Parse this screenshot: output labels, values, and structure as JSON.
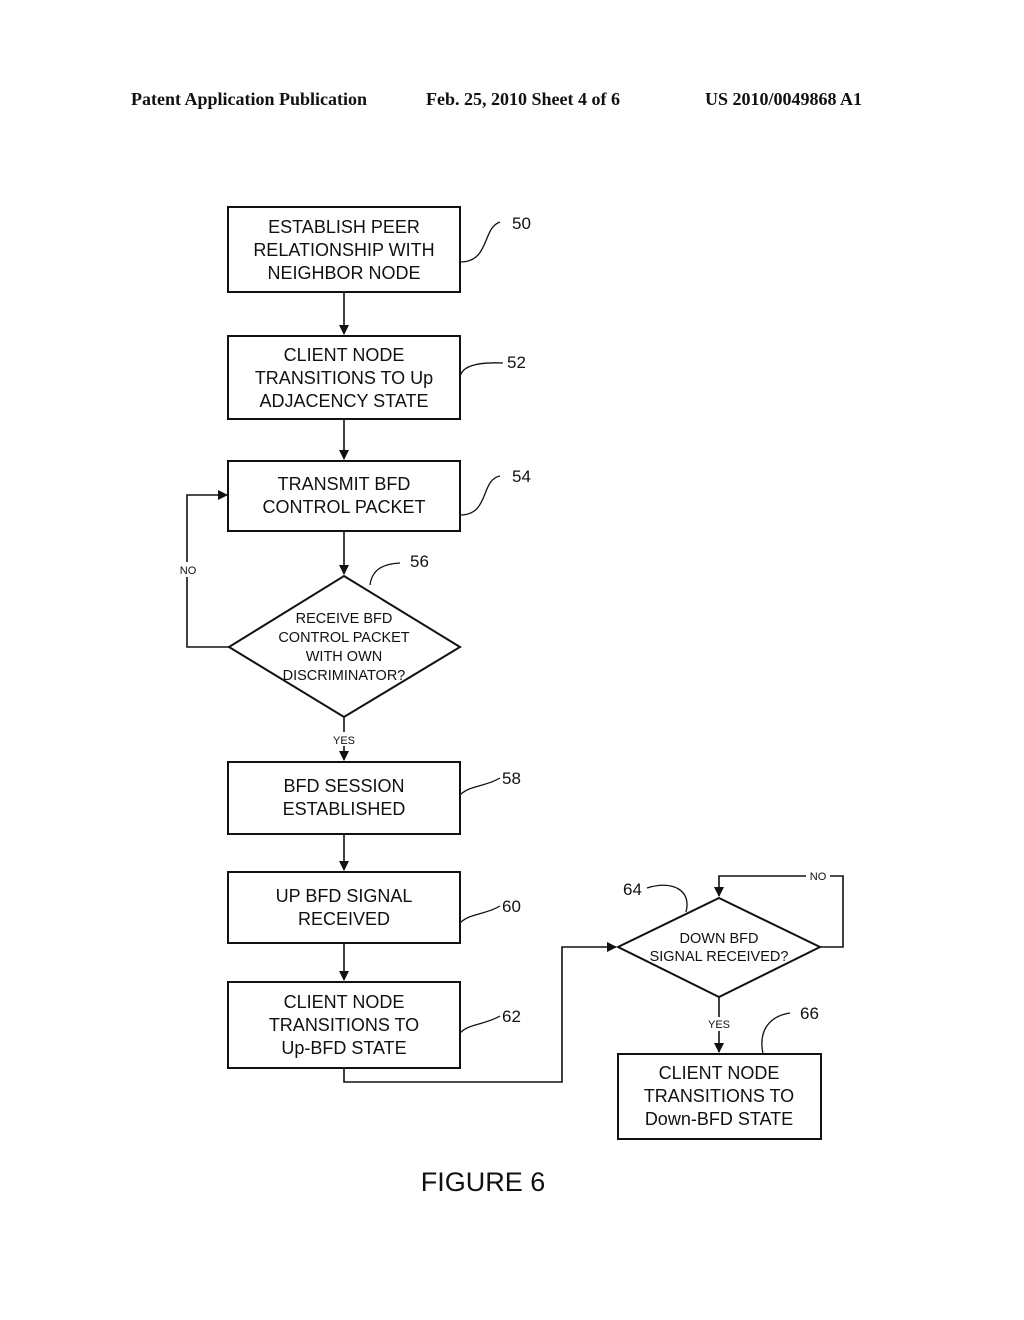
{
  "header": {
    "publication": "Patent Application Publication",
    "date_sheet": "Feb. 25, 2010   Sheet 4 of 6",
    "number": "US 2010/0049868 A1"
  },
  "nodes": {
    "n50": {
      "ref": "50",
      "lines": [
        "ESTABLISH PEER",
        "RELATIONSHIP WITH",
        "NEIGHBOR NODE"
      ]
    },
    "n52": {
      "ref": "52",
      "lines": [
        "CLIENT NODE",
        "TRANSITIONS TO Up",
        "ADJACENCY STATE"
      ]
    },
    "n54": {
      "ref": "54",
      "lines": [
        "TRANSMIT BFD",
        "CONTROL PACKET"
      ]
    },
    "n56": {
      "ref": "56",
      "lines": [
        "RECEIVE BFD",
        "CONTROL PACKET",
        "WITH OWN",
        "DISCRIMINATOR?"
      ]
    },
    "n58": {
      "ref": "58",
      "lines": [
        "BFD SESSION",
        "ESTABLISHED"
      ]
    },
    "n60": {
      "ref": "60",
      "lines": [
        "UP BFD SIGNAL",
        "RECEIVED"
      ]
    },
    "n62": {
      "ref": "62",
      "lines": [
        "CLIENT NODE",
        "TRANSITIONS TO",
        "Up-BFD STATE"
      ]
    },
    "n64": {
      "ref": "64",
      "lines": [
        "DOWN BFD",
        "SIGNAL RECEIVED?"
      ]
    },
    "n66": {
      "ref": "66",
      "lines": [
        "CLIENT NODE",
        "TRANSITIONS TO",
        "Down-BFD STATE"
      ]
    }
  },
  "edge_labels": {
    "no_56": "NO",
    "yes_56": "YES",
    "no_64": "NO",
    "yes_64": "YES"
  },
  "figure_caption": "FIGURE 6"
}
